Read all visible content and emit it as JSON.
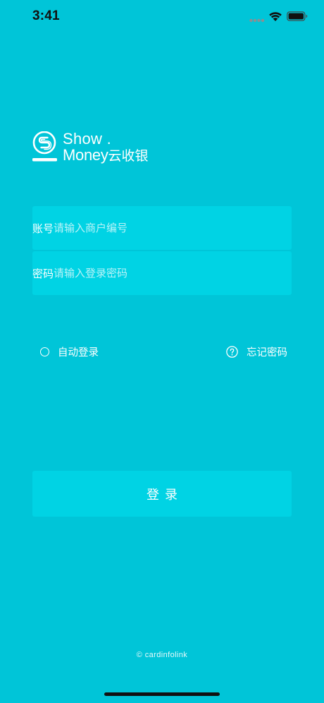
{
  "status_bar": {
    "time": "3:41",
    "icons": [
      "cellular-signal-icon",
      "wifi-icon",
      "battery-icon"
    ]
  },
  "logo": {
    "line1": "Show .",
    "line2_latin": "Money",
    "line2_chinese": "云收银",
    "mark": "show-money-logo-icon"
  },
  "form": {
    "account": {
      "label": "账号",
      "placeholder": "请输入商户编号",
      "value": ""
    },
    "password": {
      "label": "密码",
      "placeholder": "请输入登录密码",
      "value": ""
    }
  },
  "options": {
    "auto_login_label": "自动登录",
    "auto_login_checked": false,
    "forgot_password_label": "忘记密码"
  },
  "login_button": {
    "label": "登录"
  },
  "footer": {
    "copyright": "© cardinfolink"
  },
  "colors": {
    "background": "#00c5d8",
    "field_background": "#00d3e4",
    "text": "#ffffff"
  }
}
